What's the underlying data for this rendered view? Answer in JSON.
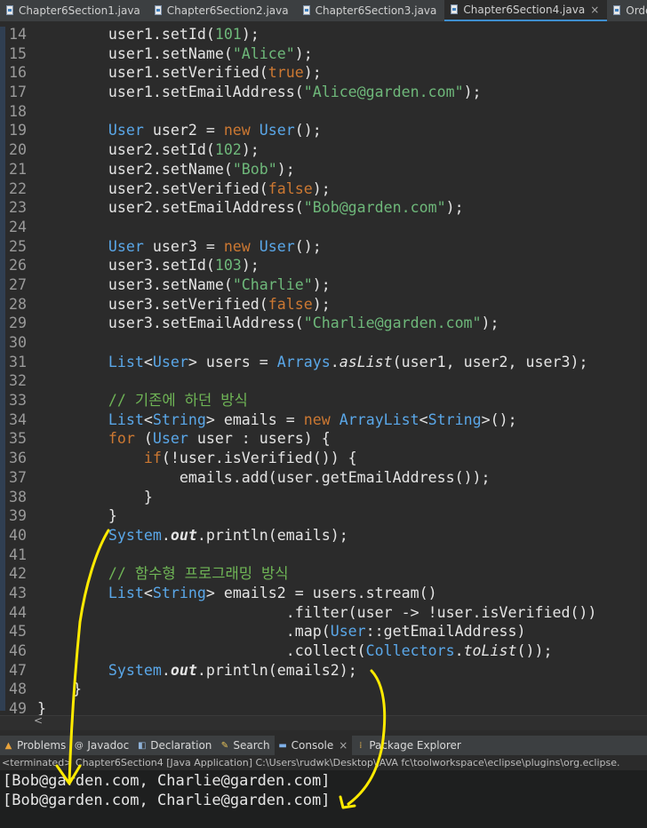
{
  "tabs": [
    {
      "label": "Chapter6Section1.java",
      "active": false
    },
    {
      "label": "Chapter6Section2.java",
      "active": false
    },
    {
      "label": "Chapter6Section3.java",
      "active": false
    },
    {
      "label": "Chapter6Section4.java",
      "active": true,
      "close": "×"
    },
    {
      "label": "Order.java",
      "active": false
    }
  ],
  "code_lines": [
    {
      "n": "14",
      "t": [
        [
          "id",
          "        user1."
        ],
        [
          "fn",
          "setId"
        ],
        [
          "id",
          "("
        ],
        [
          "st",
          "101"
        ],
        [
          "id",
          ");"
        ]
      ]
    },
    {
      "n": "15",
      "t": [
        [
          "id",
          "        user1."
        ],
        [
          "fn",
          "setName"
        ],
        [
          "id",
          "("
        ],
        [
          "st",
          "\"Alice\""
        ],
        [
          "id",
          ");"
        ]
      ]
    },
    {
      "n": "16",
      "t": [
        [
          "id",
          "        user1."
        ],
        [
          "fn",
          "setVerified"
        ],
        [
          "id",
          "("
        ],
        [
          "kw",
          "true"
        ],
        [
          "id",
          ");"
        ]
      ]
    },
    {
      "n": "17",
      "t": [
        [
          "id",
          "        user1."
        ],
        [
          "fn",
          "setEmailAddress"
        ],
        [
          "id",
          "("
        ],
        [
          "st",
          "\"Alice@garden.com\""
        ],
        [
          "id",
          ");"
        ]
      ]
    },
    {
      "n": "18",
      "t": []
    },
    {
      "n": "19",
      "t": [
        [
          "ty",
          "        User"
        ],
        [
          "id",
          " user2 = "
        ],
        [
          "kw",
          "new"
        ],
        [
          "id",
          " "
        ],
        [
          "ty",
          "User"
        ],
        [
          "id",
          "();"
        ]
      ]
    },
    {
      "n": "20",
      "t": [
        [
          "id",
          "        user2."
        ],
        [
          "fn",
          "setId"
        ],
        [
          "id",
          "("
        ],
        [
          "st",
          "102"
        ],
        [
          "id",
          ");"
        ]
      ]
    },
    {
      "n": "21",
      "t": [
        [
          "id",
          "        user2."
        ],
        [
          "fn",
          "setName"
        ],
        [
          "id",
          "("
        ],
        [
          "st",
          "\"Bob\""
        ],
        [
          "id",
          ");"
        ]
      ]
    },
    {
      "n": "22",
      "t": [
        [
          "id",
          "        user2."
        ],
        [
          "fn",
          "setVerified"
        ],
        [
          "id",
          "("
        ],
        [
          "kw",
          "false"
        ],
        [
          "id",
          ");"
        ]
      ]
    },
    {
      "n": "23",
      "t": [
        [
          "id",
          "        user2."
        ],
        [
          "fn",
          "setEmailAddress"
        ],
        [
          "id",
          "("
        ],
        [
          "st",
          "\"Bob@garden.com\""
        ],
        [
          "id",
          ");"
        ]
      ]
    },
    {
      "n": "24",
      "t": []
    },
    {
      "n": "25",
      "t": [
        [
          "ty",
          "        User"
        ],
        [
          "id",
          " user3 = "
        ],
        [
          "kw",
          "new"
        ],
        [
          "id",
          " "
        ],
        [
          "ty",
          "User"
        ],
        [
          "id",
          "();"
        ]
      ]
    },
    {
      "n": "26",
      "t": [
        [
          "id",
          "        user3."
        ],
        [
          "fn",
          "setId"
        ],
        [
          "id",
          "("
        ],
        [
          "st",
          "103"
        ],
        [
          "id",
          ");"
        ]
      ]
    },
    {
      "n": "27",
      "t": [
        [
          "id",
          "        user3."
        ],
        [
          "fn",
          "setName"
        ],
        [
          "id",
          "("
        ],
        [
          "st",
          "\"Charlie\""
        ],
        [
          "id",
          ");"
        ]
      ]
    },
    {
      "n": "28",
      "t": [
        [
          "id",
          "        user3."
        ],
        [
          "fn",
          "setVerified"
        ],
        [
          "id",
          "("
        ],
        [
          "kw",
          "false"
        ],
        [
          "id",
          ");"
        ]
      ]
    },
    {
      "n": "29",
      "t": [
        [
          "id",
          "        user3."
        ],
        [
          "fn",
          "setEmailAddress"
        ],
        [
          "id",
          "("
        ],
        [
          "st",
          "\"Charlie@garden.com\""
        ],
        [
          "id",
          ");"
        ]
      ]
    },
    {
      "n": "30",
      "t": []
    },
    {
      "n": "31",
      "t": [
        [
          "ty",
          "        List"
        ],
        [
          "id",
          "<"
        ],
        [
          "ty",
          "User"
        ],
        [
          "id",
          "> users = "
        ],
        [
          "ty",
          "Arrays"
        ],
        [
          "id",
          "."
        ],
        [
          "it",
          "asList"
        ],
        [
          "id",
          "(user1, user2, user3);"
        ]
      ]
    },
    {
      "n": "32",
      "t": []
    },
    {
      "n": "33",
      "t": [
        [
          "cm",
          "        // 기존에 하던 방식"
        ]
      ]
    },
    {
      "n": "34",
      "t": [
        [
          "ty",
          "        List"
        ],
        [
          "id",
          "<"
        ],
        [
          "ty",
          "String"
        ],
        [
          "id",
          "> emails = "
        ],
        [
          "kw",
          "new"
        ],
        [
          "id",
          " "
        ],
        [
          "ty",
          "ArrayList"
        ],
        [
          "id",
          "<"
        ],
        [
          "ty",
          "String"
        ],
        [
          "id",
          ">();"
        ]
      ]
    },
    {
      "n": "35",
      "t": [
        [
          "kw",
          "        for"
        ],
        [
          "id",
          " ("
        ],
        [
          "ty",
          "User"
        ],
        [
          "id",
          " user : users) {"
        ]
      ]
    },
    {
      "n": "36",
      "t": [
        [
          "kw",
          "            if"
        ],
        [
          "id",
          "(!user."
        ],
        [
          "fn",
          "isVerified"
        ],
        [
          "id",
          "()) {"
        ]
      ]
    },
    {
      "n": "37",
      "t": [
        [
          "id",
          "                emails."
        ],
        [
          "fn",
          "add"
        ],
        [
          "id",
          "(user."
        ],
        [
          "fn",
          "getEmailAddress"
        ],
        [
          "id",
          "());"
        ]
      ]
    },
    {
      "n": "38",
      "t": [
        [
          "id",
          "            }"
        ]
      ]
    },
    {
      "n": "39",
      "t": [
        [
          "id",
          "        }"
        ]
      ]
    },
    {
      "n": "40",
      "t": [
        [
          "ty",
          "        System"
        ],
        [
          "id",
          "."
        ],
        [
          "bi",
          "out"
        ],
        [
          "id",
          "."
        ],
        [
          "fn",
          "println"
        ],
        [
          "id",
          "(emails);"
        ]
      ]
    },
    {
      "n": "41",
      "t": []
    },
    {
      "n": "42",
      "t": [
        [
          "cm",
          "        // 함수형 프로그래밍 방식"
        ]
      ]
    },
    {
      "n": "43",
      "t": [
        [
          "ty",
          "        List"
        ],
        [
          "id",
          "<"
        ],
        [
          "ty",
          "String"
        ],
        [
          "id",
          "> emails2 = users."
        ],
        [
          "fn",
          "stream"
        ],
        [
          "id",
          "()"
        ]
      ]
    },
    {
      "n": "44",
      "t": [
        [
          "id",
          "                            ."
        ],
        [
          "fn",
          "filter"
        ],
        [
          "id",
          "(user -> !user."
        ],
        [
          "fn",
          "isVerified"
        ],
        [
          "id",
          "())"
        ]
      ]
    },
    {
      "n": "45",
      "t": [
        [
          "id",
          "                            ."
        ],
        [
          "fn",
          "map"
        ],
        [
          "id",
          "("
        ],
        [
          "ty",
          "User"
        ],
        [
          "id",
          "::"
        ],
        [
          "fn",
          "getEmailAddress"
        ],
        [
          "id",
          ")"
        ]
      ]
    },
    {
      "n": "46",
      "t": [
        [
          "id",
          "                            ."
        ],
        [
          "fn",
          "collect"
        ],
        [
          "id",
          "("
        ],
        [
          "ty",
          "Collectors"
        ],
        [
          "id",
          "."
        ],
        [
          "it",
          "toList"
        ],
        [
          "id",
          "());"
        ]
      ]
    },
    {
      "n": "47",
      "t": [
        [
          "ty",
          "        System"
        ],
        [
          "id",
          "."
        ],
        [
          "bi",
          "out"
        ],
        [
          "id",
          "."
        ],
        [
          "fn",
          "println"
        ],
        [
          "id",
          "(emails2);"
        ]
      ]
    },
    {
      "n": "48",
      "t": [
        [
          "id",
          "    }"
        ]
      ]
    },
    {
      "n": "49",
      "t": [
        [
          "id",
          "}"
        ]
      ]
    }
  ],
  "scroll": {
    "left_arrow": "<"
  },
  "views": [
    {
      "label": "Problems",
      "icon": "problems-icon",
      "active": false
    },
    {
      "label": "Javadoc",
      "icon": "javadoc-icon",
      "active": false
    },
    {
      "label": "Declaration",
      "icon": "declaration-icon",
      "active": false
    },
    {
      "label": "Search",
      "icon": "search-icon",
      "active": false
    },
    {
      "label": "Console",
      "icon": "console-icon",
      "active": true,
      "close": "×"
    },
    {
      "label": "Package Explorer",
      "icon": "package-explorer-icon",
      "active": false
    }
  ],
  "status": "<terminated> Chapter6Section4 [Java Application] C:\\Users\\rudwk\\Desktop\\JAVA fc\\toolworkspace\\eclipse\\plugins\\org.eclipse.",
  "console_output": [
    "[Bob@garden.com, Charlie@garden.com]",
    "[Bob@garden.com, Charlie@garden.com]"
  ],
  "colors": {
    "annotation": "#ffea00",
    "keyword": "#cc7832",
    "type": "#5aa7e8",
    "string": "#6eb87a"
  }
}
